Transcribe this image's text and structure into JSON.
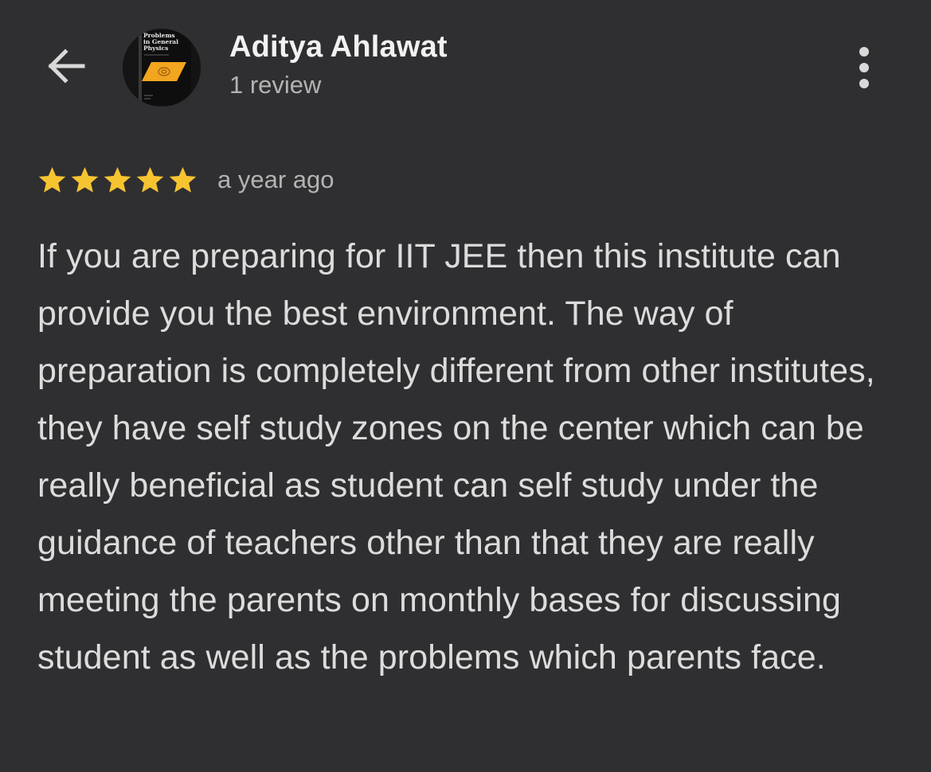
{
  "header": {
    "back_icon": "arrow-left-icon",
    "avatar_book": {
      "title_line1": "Problems",
      "title_line2": "in General",
      "title_line3": "Physics",
      "cover_color": "#f2a51f"
    },
    "reviewer_name": "Aditya Ahlawat",
    "review_count": "1 review",
    "more_icon": "more-vertical-icon"
  },
  "review": {
    "rating": 5,
    "max_rating": 5,
    "star_color": "#f7c431",
    "date": "a year ago",
    "text": "If you are preparing for IIT JEE then this institute can provide you the best environment. The way of preparation is completely different from other institutes, they have self study zones on the center which can be really beneficial as student can self study under the guidance of teachers other than that they are really meeting the parents on monthly bases for discussing student as well as the problems which parents face."
  },
  "colors": {
    "background": "#2f2f31",
    "text_primary": "#f2f2f2",
    "text_secondary": "#b3b3b3",
    "text_body": "#dcdcdc"
  }
}
